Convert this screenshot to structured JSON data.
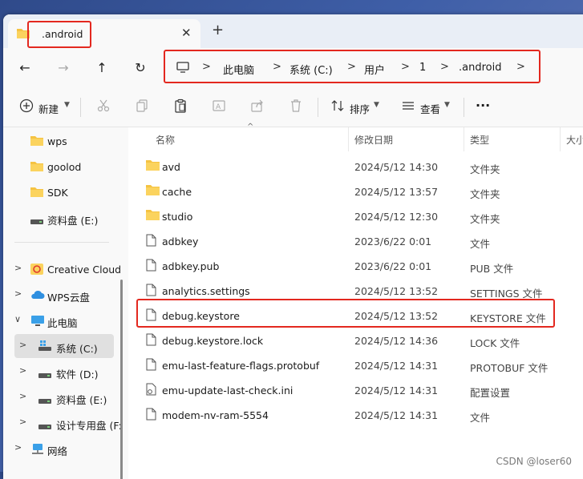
{
  "tab": {
    "title": ".android",
    "close_glyph": "✕",
    "new_tab_glyph": "+"
  },
  "nav": {
    "back": "←",
    "forward": "→",
    "up": "↑",
    "refresh": "↻"
  },
  "address": {
    "crumbs": [
      "此电脑",
      "系统 (C:)",
      "用户",
      "1",
      ".android"
    ],
    "chevron": ">"
  },
  "toolbar": {
    "new_label": "新建",
    "sort_label": "排序",
    "view_label": "查看",
    "more_label": "···"
  },
  "sidebar": {
    "items": [
      {
        "label": "wps",
        "icon": "folder-icon"
      },
      {
        "label": "goolod",
        "icon": "folder-icon"
      },
      {
        "label": "SDK",
        "icon": "folder-icon"
      },
      {
        "label": "资料盘 (E:)",
        "icon": "drive-icon"
      },
      {
        "label": "Creative Cloud",
        "icon": "creative-cloud-icon"
      },
      {
        "label": "WPS云盘",
        "icon": "cloud-icon"
      },
      {
        "label": "此电脑",
        "icon": "computer-icon"
      },
      {
        "label": "系统 (C:)",
        "icon": "system-drive-icon"
      },
      {
        "label": "软件 (D:)",
        "icon": "drive-icon"
      },
      {
        "label": "资料盘 (E:)",
        "icon": "drive-icon"
      },
      {
        "label": "设计专用盘 (F:",
        "icon": "drive-icon"
      },
      {
        "label": "网络",
        "icon": "network-icon"
      }
    ],
    "expand_glyph": ">",
    "collapse_glyph": "∨"
  },
  "columns": {
    "name": "名称",
    "date": "修改日期",
    "type": "类型",
    "size": "大小"
  },
  "files": [
    {
      "name": "avd",
      "date": "2024/5/12 14:30",
      "type": "文件夹",
      "kind": "folder"
    },
    {
      "name": "cache",
      "date": "2024/5/12 13:57",
      "type": "文件夹",
      "kind": "folder"
    },
    {
      "name": "studio",
      "date": "2024/5/12 12:30",
      "type": "文件夹",
      "kind": "folder"
    },
    {
      "name": "adbkey",
      "date": "2023/6/22 0:01",
      "type": "文件",
      "kind": "file"
    },
    {
      "name": "adbkey.pub",
      "date": "2023/6/22 0:01",
      "type": "PUB 文件",
      "kind": "file"
    },
    {
      "name": "analytics.settings",
      "date": "2024/5/12 13:52",
      "type": "SETTINGS 文件",
      "kind": "file"
    },
    {
      "name": "debug.keystore",
      "date": "2024/5/12 13:52",
      "type": "KEYSTORE 文件",
      "kind": "file"
    },
    {
      "name": "debug.keystore.lock",
      "date": "2024/5/12 14:36",
      "type": "LOCK 文件",
      "kind": "file"
    },
    {
      "name": "emu-last-feature-flags.protobuf",
      "date": "2024/5/12 14:31",
      "type": "PROTOBUF 文件",
      "kind": "file"
    },
    {
      "name": "emu-update-last-check.ini",
      "date": "2024/5/12 14:31",
      "type": "配置设置",
      "kind": "ini"
    },
    {
      "name": "modem-nv-ram-5554",
      "date": "2024/5/12 14:31",
      "type": "文件",
      "kind": "file"
    }
  ],
  "watermark": "CSDN @loser60",
  "colors": {
    "highlight": "#e3281f",
    "folder": "#f5c342",
    "selection": "#e0e0e0"
  }
}
